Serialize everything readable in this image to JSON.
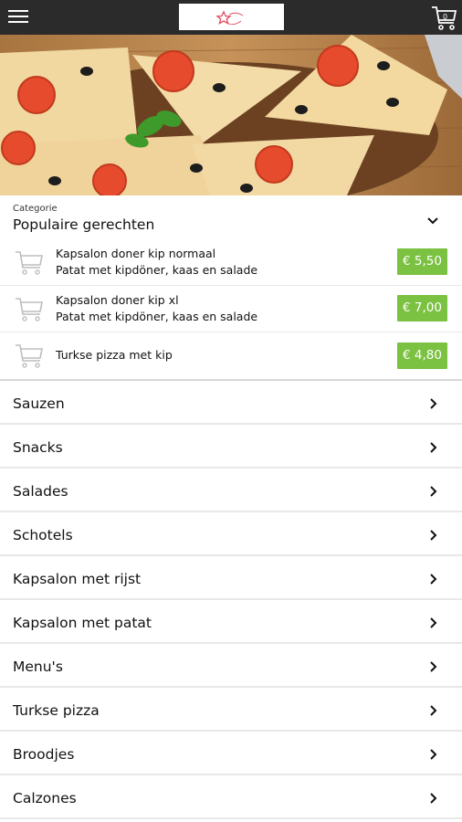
{
  "header": {
    "menu_icon": "hamburger-menu-icon",
    "logo_icon": "brand-star-logo",
    "cart_icon": "shopping-cart-icon",
    "cart_count": "0"
  },
  "hero": {
    "image": "pizza-photo"
  },
  "popular": {
    "caption": "Categorie",
    "title": "Populaire gerechten",
    "toggle_icon": "chevron-down-icon",
    "items": [
      {
        "name": "Kapsalon doner kip normaal",
        "description": "Patat met kipdöner, kaas en salade",
        "price": "€ 5,50"
      },
      {
        "name": "Kapsalon doner kip xl",
        "description": "Patat met kipdöner, kaas en salade",
        "price": "€ 7,00"
      },
      {
        "name": "Turkse pizza met kip",
        "description": "",
        "price": "€ 4,80"
      }
    ]
  },
  "categories": [
    {
      "label": "Sauzen"
    },
    {
      "label": "Snacks"
    },
    {
      "label": "Salades"
    },
    {
      "label": "Schotels"
    },
    {
      "label": "Kapsalon met rijst"
    },
    {
      "label": "Kapsalon met patat"
    },
    {
      "label": "Menu's"
    },
    {
      "label": "Turkse pizza"
    },
    {
      "label": "Broodjes"
    },
    {
      "label": "Calzones"
    }
  ],
  "colors": {
    "topbar": "#2b2b2b",
    "price_badge": "#7bc142",
    "logo_star": "#e4475a"
  }
}
